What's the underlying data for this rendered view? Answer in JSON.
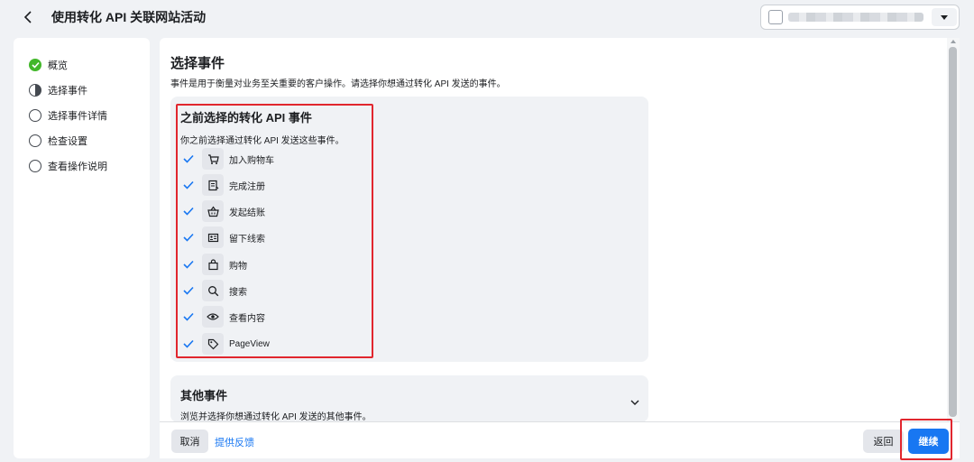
{
  "header": {
    "title": "使用转化 API 关联网站活动",
    "back_icon": "chevron-left-icon",
    "account_selector": {
      "value": "",
      "icon": "caret-down-icon"
    }
  },
  "sidebar": {
    "steps": [
      {
        "label": "概览",
        "status": "complete"
      },
      {
        "label": "选择事件",
        "status": "current"
      },
      {
        "label": "选择事件详情",
        "status": "pending"
      },
      {
        "label": "检查设置",
        "status": "pending"
      },
      {
        "label": "查看操作说明",
        "status": "pending"
      }
    ]
  },
  "main": {
    "title": "选择事件",
    "description": "事件是用于衡量对业务至关重要的客户操作。请选择你想通过转化 API 发送的事件。",
    "previous_events": {
      "title": "之前选择的转化 API 事件",
      "description": "你之前选择通过转化 API 发送这些事件。",
      "events": [
        {
          "label": "加入购物车",
          "icon": "shopping-cart-icon",
          "checked": true
        },
        {
          "label": "完成注册",
          "icon": "registration-form-icon",
          "checked": true
        },
        {
          "label": "发起结账",
          "icon": "checkout-basket-icon",
          "checked": true
        },
        {
          "label": "留下线索",
          "icon": "lead-card-icon",
          "checked": true
        },
        {
          "label": "购物",
          "icon": "shopping-bag-icon",
          "checked": true
        },
        {
          "label": "搜索",
          "icon": "search-icon",
          "checked": true
        },
        {
          "label": "查看内容",
          "icon": "eye-icon",
          "checked": true
        },
        {
          "label": "PageView",
          "icon": "tag-icon",
          "checked": true
        }
      ]
    },
    "other_events": {
      "title": "其他事件",
      "description": "浏览并选择你想通过转化 API 发送的其他事件。"
    }
  },
  "footer": {
    "cancel_label": "取消",
    "feedback_label": "提供反馈",
    "back_label": "返回",
    "continue_label": "继续"
  },
  "colors": {
    "accent": "#1877f2",
    "success": "#42b72a",
    "highlight": "#e1262e",
    "card_bg": "#f0f2f5"
  }
}
